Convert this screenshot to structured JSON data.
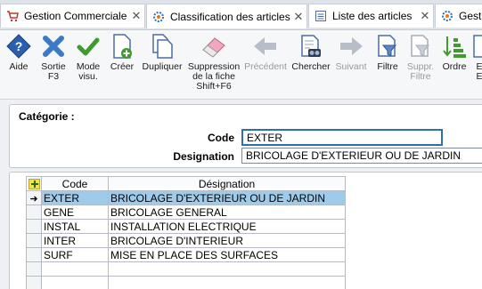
{
  "tabs": [
    {
      "label": "Gestion Commerciale",
      "icon": "cart-icon"
    },
    {
      "label": "Classification des articles",
      "icon": "gear-icon"
    },
    {
      "label": "Liste des articles",
      "icon": "list-icon"
    },
    {
      "label": "Gestio",
      "icon": "gear-icon"
    }
  ],
  "tab_close_glyph": "✕",
  "toolbar": {
    "aide": "Aide",
    "sortie": "Sortie\nF3",
    "mode_visu": "Mode\nvisu.",
    "creer": "Créer",
    "dupliquer": "Dupliquer",
    "suppression": "Suppression\nde la fiche\nShift+F6",
    "precedent": "Précédent",
    "chercher": "Chercher",
    "suivant": "Suivant",
    "filtre": "Filtre",
    "suppr_filtre": "Suppr.\nFiltre",
    "ordre": "Ordre",
    "extra": "E\nE"
  },
  "form": {
    "categorie_label": "Catégorie :",
    "code_label": "Code",
    "code_value": "EXTER",
    "designation_label": "Designation",
    "designation_value": "BRICOLAGE D'EXTERIEUR OU DE JARDIN"
  },
  "grid": {
    "headers": {
      "code": "Code",
      "designation": "Désignation"
    },
    "rows": [
      {
        "code": "EXTER",
        "designation": "BRICOLAGE D'EXTERIEUR OU DE JARDIN",
        "selected": true
      },
      {
        "code": "GENE",
        "designation": "BRICOLAGE GENERAL",
        "selected": false
      },
      {
        "code": "INSTAL",
        "designation": "INSTALLATION ELECTRIQUE",
        "selected": false
      },
      {
        "code": "INTER",
        "designation": "BRICOLAGE D'INTERIEUR",
        "selected": false
      },
      {
        "code": "SURF",
        "designation": "MISE EN PLACE DES SURFACES",
        "selected": false
      },
      {
        "code": "",
        "designation": "",
        "selected": false
      },
      {
        "code": "",
        "designation": "",
        "selected": false
      }
    ],
    "current_row_marker": "➜"
  },
  "colors": {
    "selection": "#9ecbea",
    "accent_blue": "#2f6fb1",
    "help_blue": "#2b5fb0",
    "exit_blue": "#3c79c6",
    "check_green": "#3f9b2e"
  }
}
